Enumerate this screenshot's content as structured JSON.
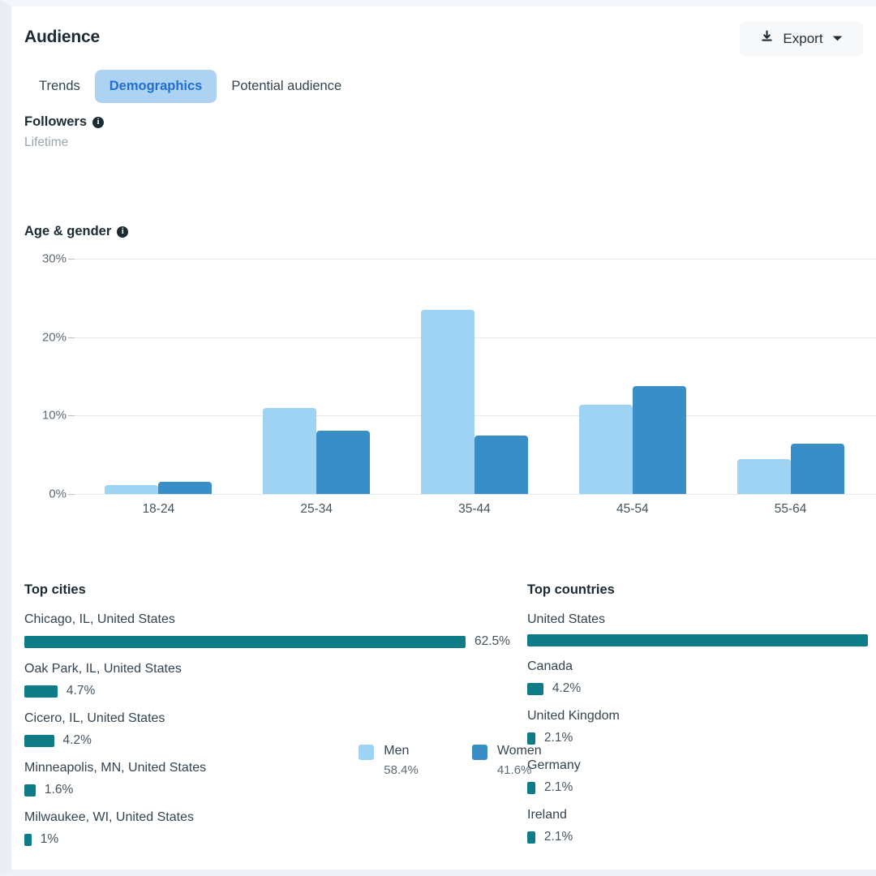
{
  "header": {
    "title": "Audience",
    "export_label": "Export",
    "download_icon": "download-icon",
    "caret_icon": "chevron-down-icon"
  },
  "tabs": [
    {
      "label": "Trends",
      "active": false
    },
    {
      "label": "Demographics",
      "active": true
    },
    {
      "label": "Potential audience",
      "active": false
    }
  ],
  "followers": {
    "title": "Followers",
    "info_icon": "info-icon",
    "subtitle": "Lifetime"
  },
  "chart_section": {
    "title": "Age & gender",
    "info_icon": "info-icon"
  },
  "chart_data": {
    "type": "bar",
    "title": "Age & gender",
    "xlabel": "",
    "ylabel": "",
    "ylim": [
      0,
      30
    ],
    "yticks": [
      "0%",
      "10%",
      "20%",
      "30%"
    ],
    "grid": true,
    "legend_position": "bottom",
    "categories": [
      "18-24",
      "25-34",
      "35-44",
      "45-54",
      "55-64"
    ],
    "series": [
      {
        "name": "Men",
        "color": "#9ed3f3",
        "total": "58.4%",
        "values": [
          1.1,
          11.0,
          23.5,
          11.4,
          4.5
        ]
      },
      {
        "name": "Women",
        "color": "#3a8ec8",
        "total": "41.6%",
        "values": [
          1.6,
          8.1,
          7.5,
          13.8,
          6.4
        ]
      }
    ]
  },
  "top_cities": {
    "title": "Top cities",
    "items": [
      {
        "name": "Chicago,  IL,  United States",
        "value": "62.5%",
        "pct": 62.5
      },
      {
        "name": "Oak Park,  IL,  United States",
        "value": "4.7%",
        "pct": 4.7
      },
      {
        "name": "Cicero,  IL,  United States",
        "value": "4.2%",
        "pct": 4.2
      },
      {
        "name": "Minneapolis,  MN,  United States",
        "value": "1.6%",
        "pct": 1.6
      },
      {
        "name": "Milwaukee,  WI,  United States",
        "value": "1%",
        "pct": 1.0
      }
    ]
  },
  "top_countries": {
    "title": "Top countries",
    "items": [
      {
        "name": "United States",
        "value": "",
        "pct": 89.0
      },
      {
        "name": "Canada",
        "value": "4.2%",
        "pct": 4.2
      },
      {
        "name": "United Kingdom",
        "value": "2.1%",
        "pct": 2.1
      },
      {
        "name": "Germany",
        "value": "2.1%",
        "pct": 2.1
      },
      {
        "name": "Ireland",
        "value": "2.1%",
        "pct": 2.1
      }
    ]
  },
  "colors": {
    "accent_blue": "#1f6fd0",
    "tab_active_bg": "#aed2f2",
    "men_bar": "#9ed3f3",
    "women_bar": "#3a8ec8",
    "teal_bar": "#0e7c86"
  }
}
